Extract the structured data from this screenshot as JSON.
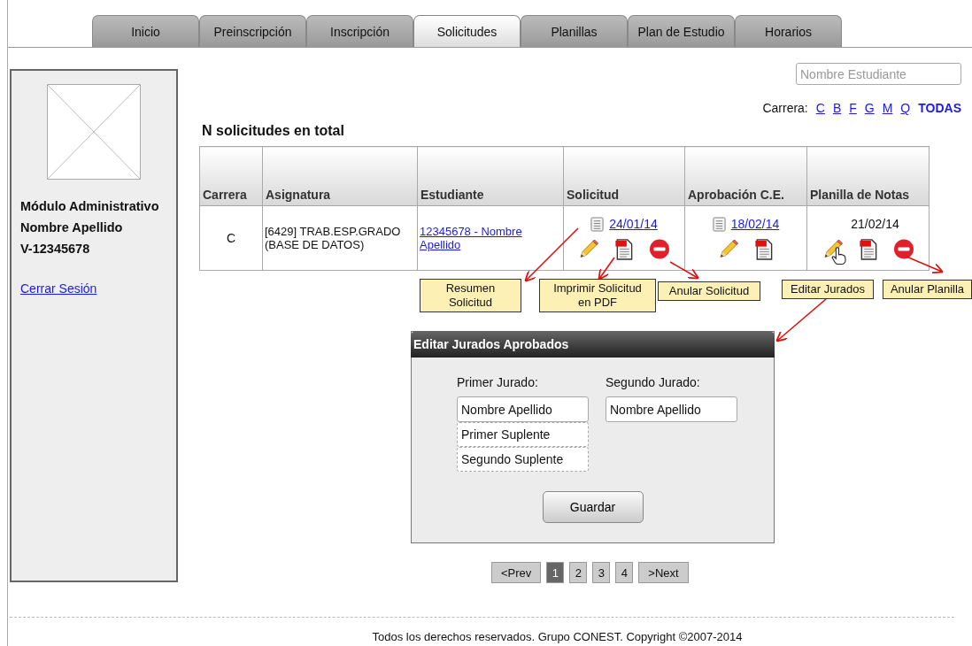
{
  "tabs": [
    {
      "label": "Inicio",
      "selected": false
    },
    {
      "label": "Preinscripción",
      "selected": false
    },
    {
      "label": "Inscripción",
      "selected": false
    },
    {
      "label": "Solicitudes",
      "selected": true
    },
    {
      "label": "Planillas",
      "selected": false
    },
    {
      "label": "Plan de Estudio",
      "selected": false
    },
    {
      "label": "Horarios",
      "selected": false
    }
  ],
  "sidebar": {
    "lines": [
      "Módulo Administrativo",
      "Nombre Apellido",
      "V-12345678"
    ],
    "logout": "Cerrar Sesión"
  },
  "search": {
    "placeholder": "Nombre Estudiante"
  },
  "career_filter": {
    "label": "Carrera:",
    "options": [
      {
        "label": "C",
        "selected": false
      },
      {
        "label": "B",
        "selected": false
      },
      {
        "label": "F",
        "selected": false
      },
      {
        "label": "G",
        "selected": false
      },
      {
        "label": "M",
        "selected": false
      },
      {
        "label": "Q",
        "selected": false
      },
      {
        "label": "TODAS",
        "selected": true
      }
    ]
  },
  "heading": "N solicitudes en total",
  "table": {
    "columns": [
      "Carrera",
      "Asignatura",
      "Estudiante",
      "Solicitud",
      "Aprobación C.E.",
      "Planilla de Notas"
    ],
    "rows": [
      {
        "carrera": "C",
        "asignatura": "[6429] TRAB.ESP.GRADO (BASE DE DATOS)",
        "estudiante": "12345678 - Nombre Apellido",
        "stages": [
          {
            "kind": "link",
            "date": "24/01/14",
            "actions": [
              {
                "kind": "edit",
                "pointer": false
              },
              {
                "kind": "pdf",
                "pointer": false
              },
              {
                "kind": "cancel",
                "pointer": false
              }
            ]
          },
          {
            "kind": "link",
            "date": "18/02/14",
            "actions": [
              {
                "kind": "edit",
                "pointer": false
              },
              {
                "kind": "pdf",
                "pointer": false
              }
            ]
          },
          {
            "kind": "text",
            "date": "21/02/14",
            "actions": [
              {
                "kind": "edit",
                "pointer": true
              },
              {
                "kind": "pdf",
                "pointer": false
              },
              {
                "kind": "cancel",
                "pointer": false
              }
            ]
          }
        ]
      }
    ]
  },
  "annotations": [
    {
      "lines": [
        "Resumen",
        "Solicitud"
      ]
    },
    {
      "lines": [
        "Imprimir Solicitud",
        "en PDF"
      ]
    },
    {
      "lines": [
        "Anular Solicitud"
      ]
    },
    {
      "lines": [
        "Editar Jurados"
      ]
    },
    {
      "lines": [
        "Anular Planilla"
      ]
    }
  ],
  "dialog": {
    "title": "Editar Jurados Aprobados",
    "groups": [
      {
        "label": "Primer Jurado:",
        "fields": [
          {
            "kind": "main",
            "value": "Nombre Apellido"
          },
          {
            "kind": "alternate",
            "value": "Primer Suplente"
          },
          {
            "kind": "alternate",
            "value": "Segundo Suplente"
          }
        ]
      },
      {
        "label": "Segundo Jurado:",
        "fields": [
          {
            "kind": "main",
            "value": "Nombre Apellido"
          }
        ]
      }
    ],
    "button": "Guardar"
  },
  "pagination": {
    "prev": "<Prev",
    "pages": [
      {
        "label": "1",
        "selected": true
      },
      {
        "label": "2",
        "selected": false
      },
      {
        "label": "3",
        "selected": false
      },
      {
        "label": "4",
        "selected": false
      }
    ],
    "next": ">Next"
  },
  "footer": "Todos los derechos reservados. Grupo CONEST. Copyright ©2007-2014"
}
